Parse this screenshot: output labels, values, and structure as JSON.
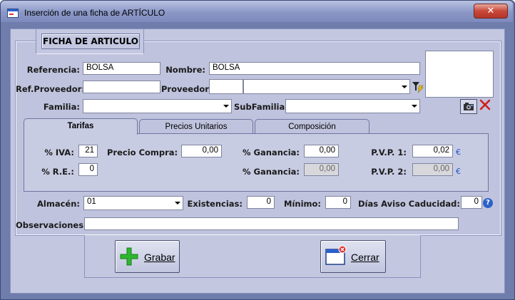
{
  "window": {
    "title": "Inserción de una ficha de ARTÍCULO",
    "close_label": "✕"
  },
  "section": {
    "title": "FICHA DE ARTICULO"
  },
  "form": {
    "referencia_label": "Referencia:",
    "referencia_value": "BOLSA",
    "nombre_label": "Nombre:",
    "nombre_value": "BOLSA",
    "refproveedor_label": "Ref.Proveedor:",
    "refproveedor_value": "",
    "proveedor_label": "Proveedor:",
    "proveedor_code": "",
    "proveedor_value": "",
    "familia_label": "Familia:",
    "familia_value": "",
    "subfamilia_label": "SubFamilia:",
    "subfamilia_value": ""
  },
  "tabs": [
    {
      "label": "Tarifas",
      "active": true
    },
    {
      "label": "Precios Unitarios",
      "active": false
    },
    {
      "label": "Composición",
      "active": false
    }
  ],
  "tarifas": {
    "iva_label": "% IVA:",
    "iva_value": "21",
    "re_label": "% R.E.:",
    "re_value": "0",
    "precio_compra_label": "Precio Compra:",
    "precio_compra_value": "0,00",
    "ganancia1_label": "% Ganancia:",
    "ganancia1_value": "0,00",
    "ganancia2_label": "% Ganancia:",
    "ganancia2_value": "0,00",
    "pvp1_label": "P.V.P. 1:",
    "pvp1_value": "0,02",
    "pvp2_label": "P.V.P. 2:",
    "pvp2_value": "0,00",
    "currency": "€"
  },
  "stock": {
    "almacen_label": "Almacén:",
    "almacen_value": "01",
    "existencias_label": "Existencias:",
    "existencias_value": "0",
    "minimo_label": "Mínimo:",
    "minimo_value": "0",
    "caducidad_label": "Días Aviso Caducidad:",
    "caducidad_value": "0",
    "observaciones_label": "Observaciones:",
    "observaciones_value": ""
  },
  "buttons": {
    "grabar": "Grabar",
    "cerrar": "Cerrar"
  },
  "colors": {
    "grabar_icon": "#2fb62f",
    "delete_icon": "#d11d1d",
    "accent": "#2a62c9"
  }
}
